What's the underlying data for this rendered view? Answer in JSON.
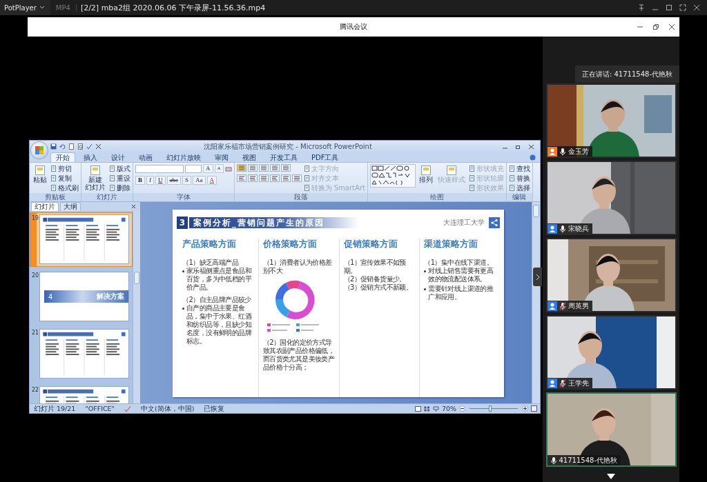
{
  "player": {
    "app": "PotPlayer",
    "format": "MP4",
    "file_title": "[2/2] mba2组 2020.06.06 下午录屏-11.56.36.mp4"
  },
  "meeting": {
    "title": "腾讯会议",
    "speaking_label": "正在讲话: 41711548-代艳秋"
  },
  "participants": [
    {
      "name": "金玉芳",
      "color": "#f07a1e",
      "muted": false,
      "speaking": false
    },
    {
      "name": "宋晓兵",
      "color": "#2b7de9",
      "muted": false,
      "speaking": false
    },
    {
      "name": "周英男",
      "color": "#2b7de9",
      "muted": true,
      "speaking": false
    },
    {
      "name": "王学先",
      "color": "#2b7de9",
      "muted": true,
      "speaking": false
    },
    {
      "name": "41711548-代艳秋",
      "muted": false,
      "speaking": true
    }
  ],
  "presentation": {
    "window_title": "沈阳家乐福市场营销案例研究 - Microsoft PowerPoint",
    "tabs": [
      {
        "label": "开始",
        "selected": true
      },
      {
        "label": "插入",
        "selected": false
      },
      {
        "label": "设计",
        "selected": false
      },
      {
        "label": "动画",
        "selected": false
      },
      {
        "label": "幻灯片放映",
        "selected": false
      },
      {
        "label": "审阅",
        "selected": false
      },
      {
        "label": "视图",
        "selected": false
      },
      {
        "label": "开发工具",
        "selected": false
      },
      {
        "label": "PDF工具",
        "selected": false
      }
    ],
    "groups": [
      {
        "kind": "clipboard",
        "label": "剪贴板",
        "large": {
          "label_lines": [
            "粘贴"
          ],
          "disabled": false
        },
        "items": [
          {
            "label": "剪切",
            "disabled": false
          },
          {
            "label": "复制",
            "disabled": false
          },
          {
            "label": "格式刷",
            "disabled": false
          }
        ]
      },
      {
        "kind": "slides",
        "label": "幻灯片",
        "large": {
          "label_lines": [
            "新建",
            "幻灯片"
          ],
          "disabled": false
        },
        "items": [
          {
            "label": "版式",
            "disabled": false
          },
          {
            "label": "重设",
            "disabled": false
          },
          {
            "label": "删除",
            "disabled": false
          }
        ]
      },
      {
        "kind": "font",
        "label": "字体",
        "size_buttons": [
          "A",
          "A"
        ],
        "format_buttons": [
          "B",
          "I",
          "U",
          "abc",
          "S",
          "Aa",
          "A"
        ]
      },
      {
        "kind": "paragraph",
        "label": "段落",
        "items": [
          {
            "label": "文字方向",
            "disabled": true
          },
          {
            "label": "对齐文本",
            "disabled": true
          },
          {
            "label": "转换为 SmartArt",
            "disabled": true
          }
        ]
      },
      {
        "kind": "drawing",
        "label": "绘图",
        "large_buttons": [
          {
            "label_lines": [
              "排列"
            ],
            "disabled": false
          },
          {
            "label_lines": [
              "快速样式"
            ],
            "disabled": true
          }
        ],
        "items": [
          {
            "label": "形状填充",
            "disabled": true
          },
          {
            "label": "形状轮廓",
            "disabled": true
          },
          {
            "label": "形状效果",
            "disabled": true
          }
        ]
      },
      {
        "kind": "editing",
        "label": "编辑",
        "items": [
          {
            "label": "查找",
            "disabled": false
          },
          {
            "label": "替换",
            "disabled": false
          },
          {
            "label": "选择",
            "disabled": false
          }
        ]
      }
    ],
    "pane_tabs": [
      {
        "label": "幻灯片",
        "selected": true
      },
      {
        "label": "大纲",
        "selected": false
      }
    ],
    "slides": [
      {
        "number": "19",
        "kind": "content",
        "selected": true
      },
      {
        "number": "20",
        "kind": "section",
        "selected": false,
        "section_number": "4",
        "section_title": "解决方案"
      },
      {
        "number": "21",
        "kind": "content",
        "selected": false
      },
      {
        "number": "22",
        "kind": "content",
        "selected": false
      }
    ],
    "slide": {
      "section_number": "3",
      "title": "案例分析_营销问题产生的原因",
      "organization": "大连理工大学",
      "columns": [
        {
          "heading": "产品策略方面",
          "blocks": [
            {
              "kind": "point",
              "text": "（1）缺乏高端产品"
            },
            {
              "kind": "bullet",
              "text": "家乐福侧重点是食品和百货，多为中低档的平价产品。"
            },
            {
              "kind": "point",
              "text": "（2）自主品牌产品较少"
            },
            {
              "kind": "bullet",
              "text": "自产的商品主要是食品，集中于水果、红酒和纺织品等，且缺少知名度，没有鲜明的品牌标志。"
            }
          ]
        },
        {
          "heading": "价格策略方面",
          "blocks": [
            {
              "kind": "point",
              "text": "（1）消费者认为价格差别不大"
            },
            {
              "kind": "chart"
            },
            {
              "kind": "point",
              "text": "（2）国化的定价方式导致其农副产品价格偏低，而百货类尤其是美妆类产品价格十分高；"
            }
          ]
        },
        {
          "heading": "促销策略方面",
          "blocks": [
            {
              "kind": "line",
              "text": "（1）宣传效果不如预期。"
            },
            {
              "kind": "line",
              "text": "（2）促销备货量少。"
            },
            {
              "kind": "line",
              "text": "（3）促销方式不新颖。"
            }
          ]
        },
        {
          "heading": "渠道策略方面",
          "blocks": [
            {
              "kind": "point",
              "text": "（1）集中在线下渠道。"
            },
            {
              "kind": "bullet",
              "text": "对线上销售需要有更高效的物流配送体系。"
            },
            {
              "kind": "bullet",
              "text": "需要针对线上渠道的推广和应用。"
            }
          ]
        }
      ]
    },
    "status": {
      "slide_counter": "幻灯片 19/21",
      "theme": "\"OFFICE\"",
      "language": "中文(简体，中国)",
      "state": "已恢复",
      "zoom": {
        "reading": "70%",
        "level": 0.4
      }
    }
  }
}
